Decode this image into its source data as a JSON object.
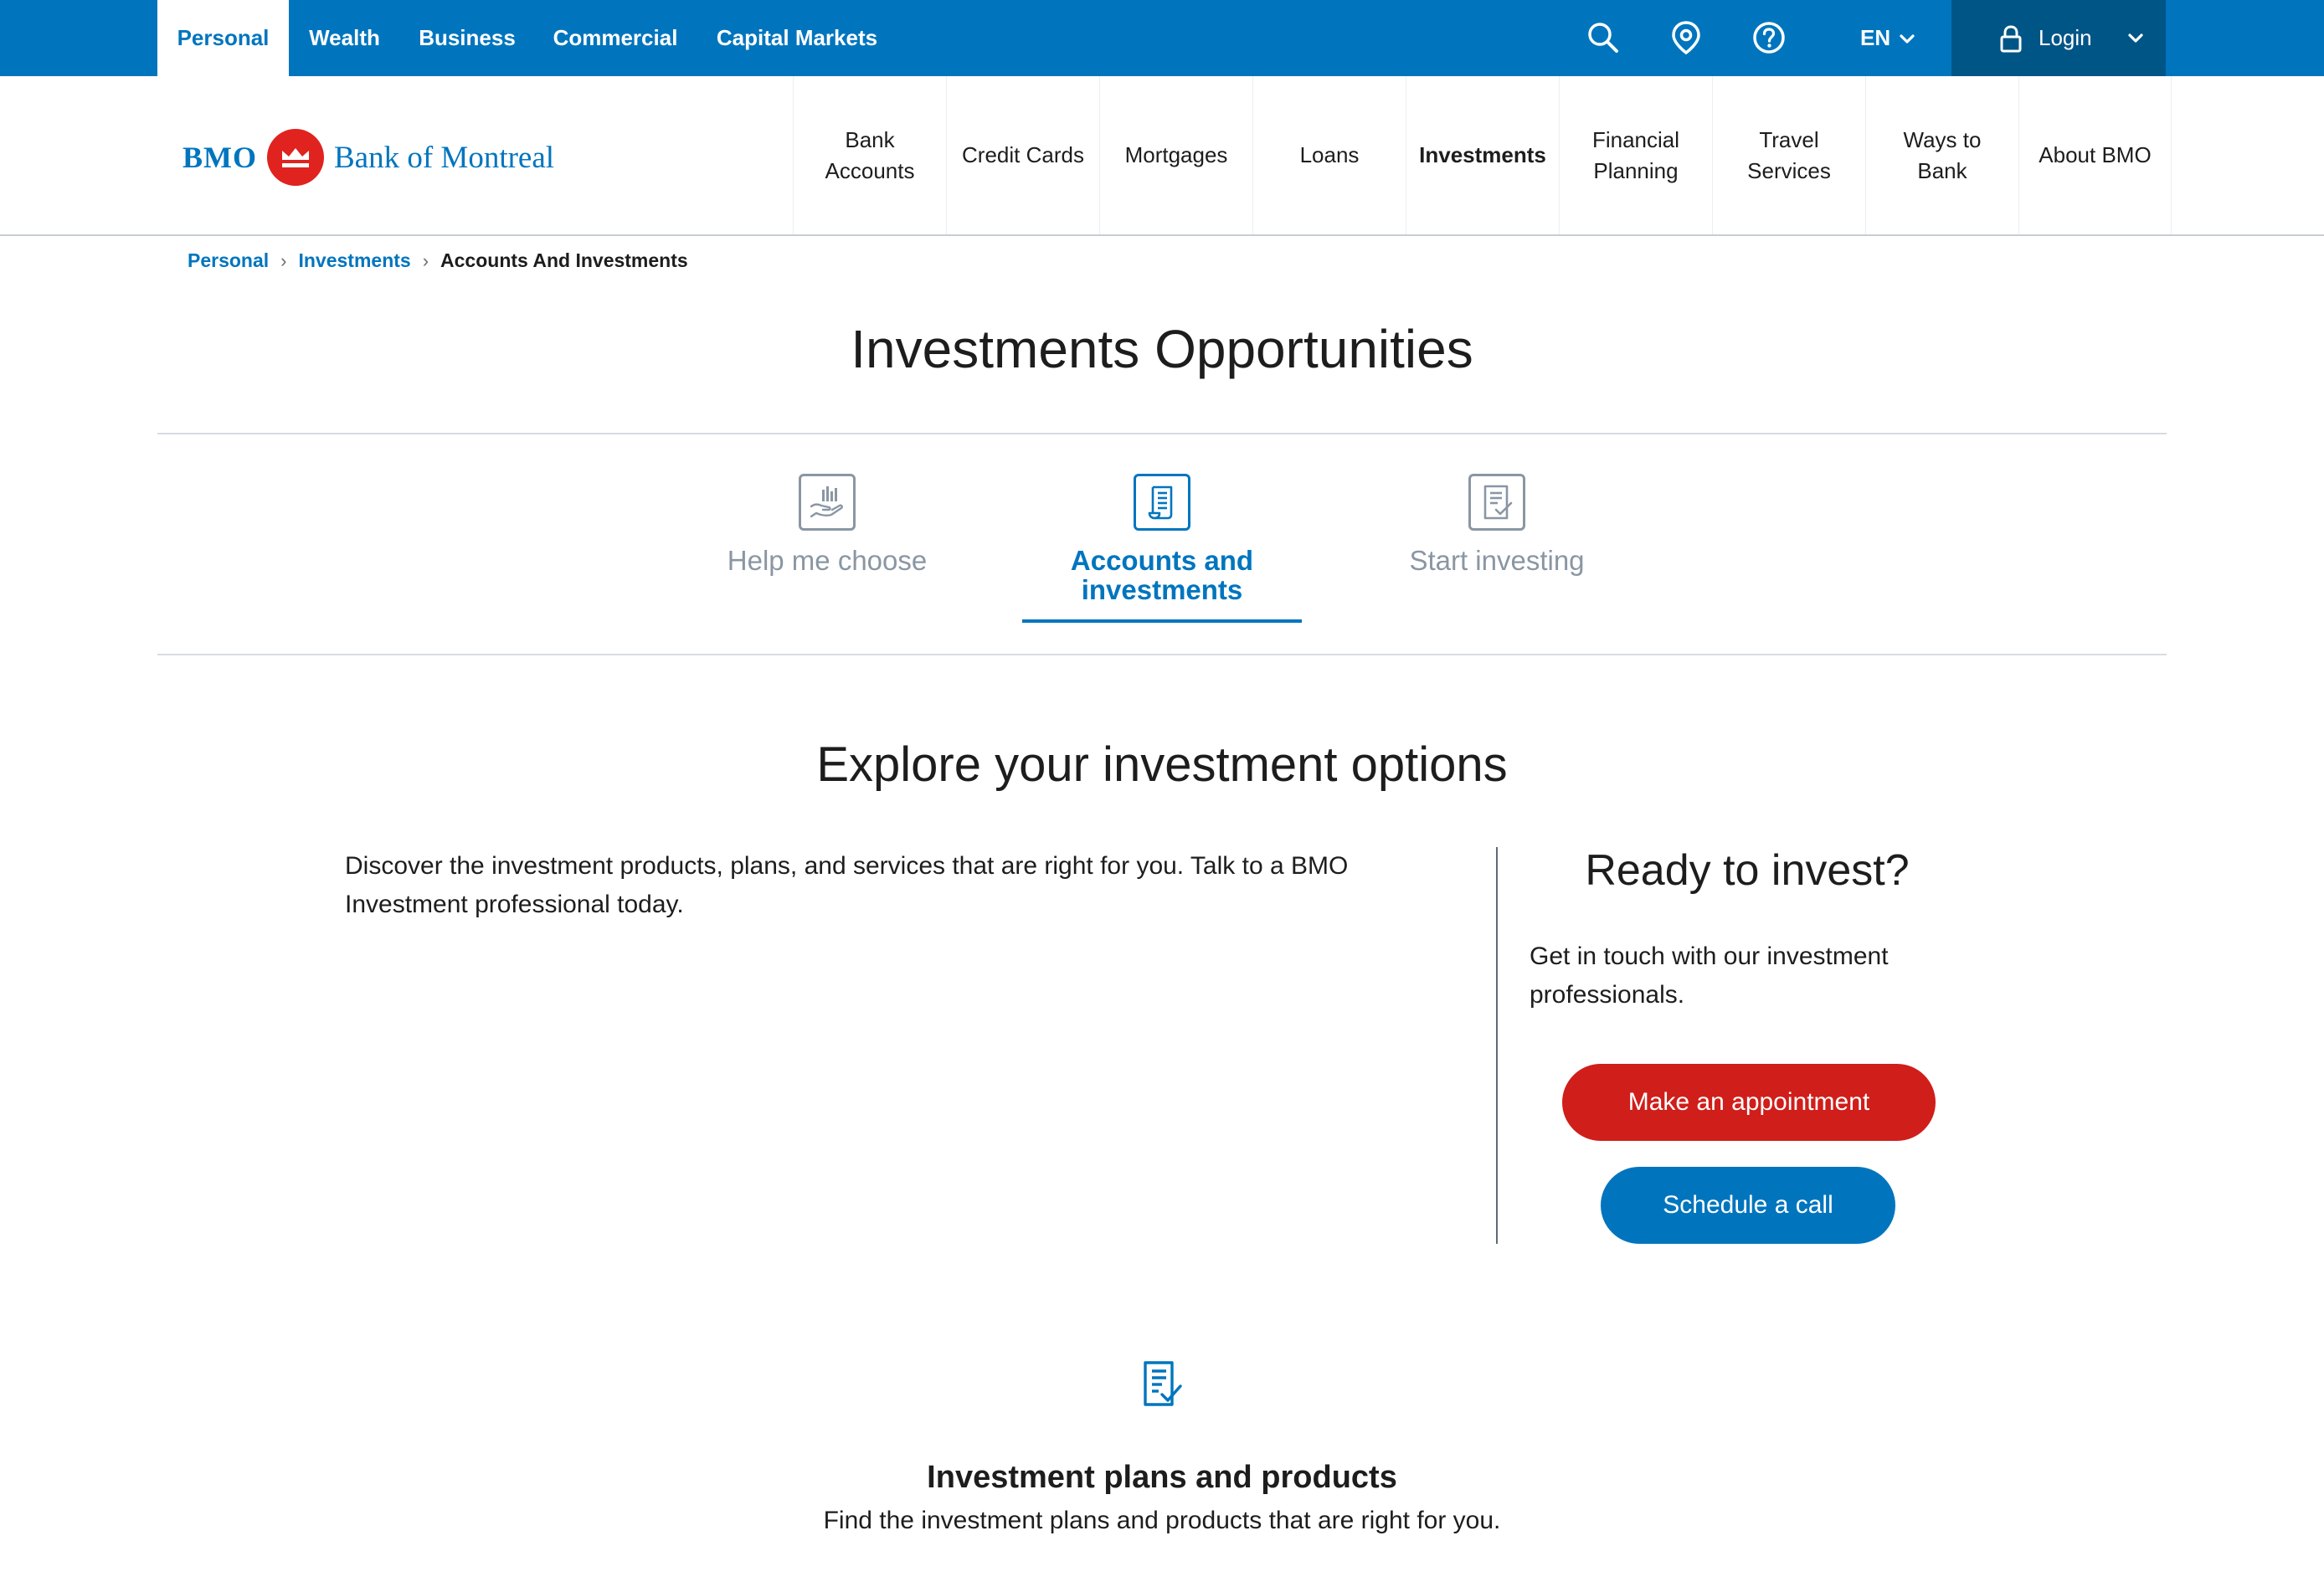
{
  "topbar": {
    "segments": [
      "Personal",
      "Wealth",
      "Business",
      "Commercial",
      "Capital Markets"
    ],
    "active_segment": "Personal",
    "icons": [
      "search-icon",
      "location-pin-icon",
      "help-icon"
    ],
    "lang": "EN",
    "login_label": "Login"
  },
  "logo": {
    "short": "BMO",
    "full": "Bank of Montreal"
  },
  "nav": {
    "items": [
      "Bank Accounts",
      "Credit Cards",
      "Mortgages",
      "Loans",
      "Investments",
      "Financial Planning",
      "Travel Services",
      "Ways to Bank",
      "About BMO"
    ],
    "item_lines": [
      [
        "Bank",
        "Accounts"
      ],
      [
        "Credit Cards"
      ],
      [
        "Mortgages"
      ],
      [
        "Loans"
      ],
      [
        "Investments"
      ],
      [
        "Financial",
        "Planning"
      ],
      [
        "Travel",
        "Services"
      ],
      [
        "Ways to",
        "Bank"
      ],
      [
        "About BMO"
      ]
    ],
    "active": "Investments"
  },
  "breadcrumb": {
    "items": [
      "Personal",
      "Investments"
    ],
    "current": "Accounts And Investments"
  },
  "page_title": "Investments Opportunities",
  "tabs": [
    {
      "label": "Help me choose",
      "icon": "hand-chart-icon",
      "active": false
    },
    {
      "label": "Accounts and investments",
      "label_lines": [
        "Accounts and",
        "investments"
      ],
      "icon": "document-list-icon",
      "active": true
    },
    {
      "label": "Start investing",
      "icon": "document-check-icon",
      "active": false
    }
  ],
  "explore": {
    "heading": "Explore your investment options",
    "intro": "Discover the investment products, plans, and services that are right for you. Talk to a BMO Investment professional today."
  },
  "ready": {
    "heading": "Ready to invest?",
    "text": "Get in touch with our investment professionals.",
    "primary_button": "Make an appointment",
    "secondary_button": "Schedule a call"
  },
  "plans": {
    "icon": "document-check-icon",
    "title": "Investment plans and products",
    "subtitle": "Find the investment plans and products that are right for you."
  },
  "colors": {
    "brand_blue": "#0075be",
    "dark_blue": "#005587",
    "brand_red": "#d01e1a",
    "logo_red": "#e0231e",
    "muted_gray": "#8a96a3"
  }
}
